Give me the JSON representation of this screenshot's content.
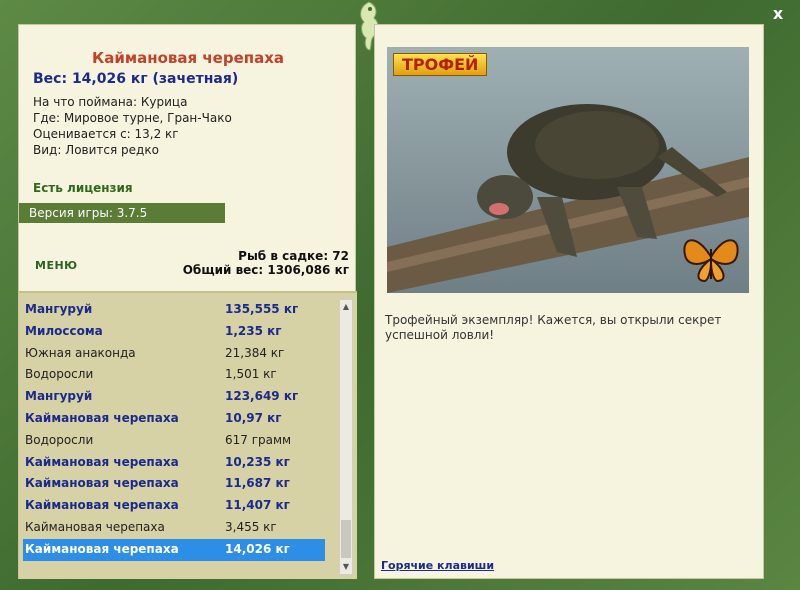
{
  "window": {
    "close_label": "x"
  },
  "fish": {
    "title": "Каймановая черепаха",
    "weight_line": "Вес: 14,026 кг (зачетная)",
    "bait_line": "На что поймана: Курица",
    "place_line": "Где: Мировое турне, Гран-Чако",
    "rated_line": "Оценивается с: 13,2 кг",
    "kind_line": "Вид: Ловится редко"
  },
  "status": {
    "license": "Есть лицензия",
    "version": "Версия игры: 3.7.5"
  },
  "menu": {
    "label": "МЕНЮ"
  },
  "cage": {
    "count_line": "Рыб в садке: 72",
    "total_line": "Общий вес: 1306,086 кг"
  },
  "catch_list": [
    {
      "name": "Мангуруй",
      "weight": "135,555 кг",
      "bold": true
    },
    {
      "name": "Милоссома",
      "weight": "1,235 кг",
      "bold": true
    },
    {
      "name": "Южная анаконда",
      "weight": "21,384 кг",
      "bold": false
    },
    {
      "name": "Водоросли",
      "weight": "1,501 кг",
      "bold": false
    },
    {
      "name": "Мангуруй",
      "weight": "123,649 кг",
      "bold": true
    },
    {
      "name": "Каймановая черепаха",
      "weight": "10,97 кг",
      "bold": true
    },
    {
      "name": "Водоросли",
      "weight": "617 грамм",
      "bold": false
    },
    {
      "name": "Каймановая черепаха",
      "weight": "10,235 кг",
      "bold": true
    },
    {
      "name": "Каймановая черепаха",
      "weight": "11,687 кг",
      "bold": true
    },
    {
      "name": "Каймановая черепаха",
      "weight": "11,407 кг",
      "bold": true
    },
    {
      "name": "Каймановая черепаха",
      "weight": "3,455 кг",
      "bold": false
    },
    {
      "name": "Каймановая черепаха",
      "weight": "14,026 кг",
      "bold": true,
      "selected": true
    }
  ],
  "trophy": {
    "badge": "ТРОФЕЙ",
    "text": "Трофейный экземпляр! Кажется, вы открыли секрет успешной ловли!"
  },
  "footer": {
    "hotkeys": "Горячие клавиши"
  },
  "icons": {
    "close": "close-icon",
    "logo": "chameleon-logo-icon",
    "scroll_up": "triangle-up-icon",
    "scroll_down": "triangle-down-icon",
    "butterfly": "butterfly-icon"
  },
  "colors": {
    "frame": "#4e7a3c",
    "panel": "#f6f3df",
    "title": "#c0422a",
    "link": "#1b2a8c",
    "selected": "#2c8ee6"
  }
}
